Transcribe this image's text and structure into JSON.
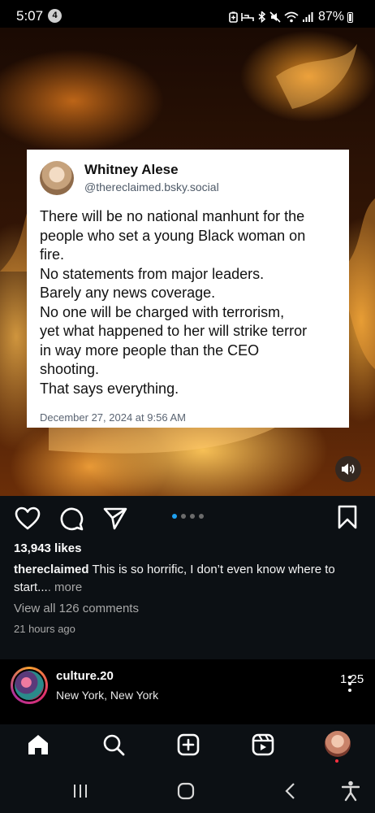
{
  "status_bar": {
    "time": "5:07",
    "notification_count": "4",
    "battery_percent": "87%",
    "icons": [
      "battery-saver-icon",
      "sleep-icon",
      "bluetooth-icon",
      "mute-icon",
      "wifi-icon",
      "signal-icon",
      "battery-icon"
    ]
  },
  "post": {
    "image": {
      "tweet": {
        "author_name": "Whitney Alese",
        "author_handle": "@thereclaimed.bsky.social",
        "text_lines": [
          "There will be no national manhunt for the",
          "people who set a young Black woman on",
          "fire.",
          "No statements from major leaders.",
          "Barely any news coverage.",
          "No one will be charged with terrorism,",
          "yet what happened to her will strike terror",
          "in way more people than the CEO",
          "shooting.",
          "That says everything."
        ],
        "date": "December 27, 2024 at 9:56 AM"
      }
    },
    "carousel": {
      "total": 4,
      "active_index": 0
    },
    "likes": "13,943 likes",
    "caption": {
      "username": "thereclaimed",
      "text": "This is so horrific, I don’t even know where to start...",
      "more": ". more"
    },
    "view_comments": "View all 126 comments",
    "time_ago": "21 hours ago"
  },
  "next_post": {
    "username": "culture.20",
    "location": "New York, New York",
    "duration": "1:25"
  },
  "bottom_nav": {
    "items": [
      "home-icon",
      "search-icon",
      "create-icon",
      "reels-icon",
      "profile-avatar"
    ]
  },
  "colors": {
    "app_background": "#0c1014",
    "accent_blue": "#1ea0f0",
    "muted_text": "#a8a8a8"
  }
}
